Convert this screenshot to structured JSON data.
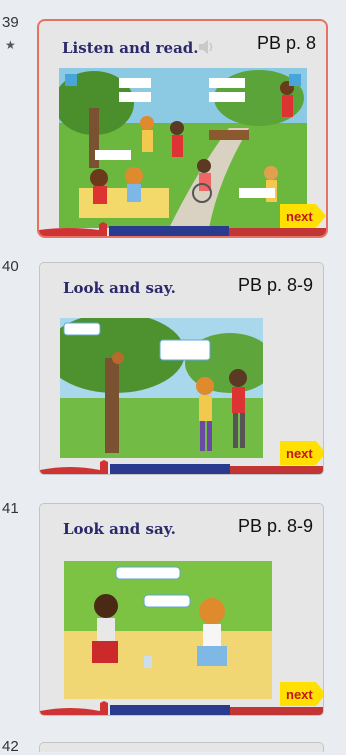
{
  "slides": [
    {
      "number": "39",
      "title": "Listen and read.",
      "pb": "PB p. 8",
      "next": "next",
      "has_star": true,
      "has_audio": true
    },
    {
      "number": "40",
      "title": "Look and say.",
      "pb": "PB p. 8-9",
      "next": "next"
    },
    {
      "number": "41",
      "title": "Look and say.",
      "pb": "PB p. 8-9",
      "next": "next"
    }
  ],
  "star_glyph": "★",
  "partial_number": "42",
  "colors": {
    "title": "#2a2a6b",
    "selected_border": "#e87262",
    "next_bg": "#ffe000",
    "next_text": "#c4151c"
  },
  "icons": [
    "speaker-icon",
    "star-icon"
  ]
}
